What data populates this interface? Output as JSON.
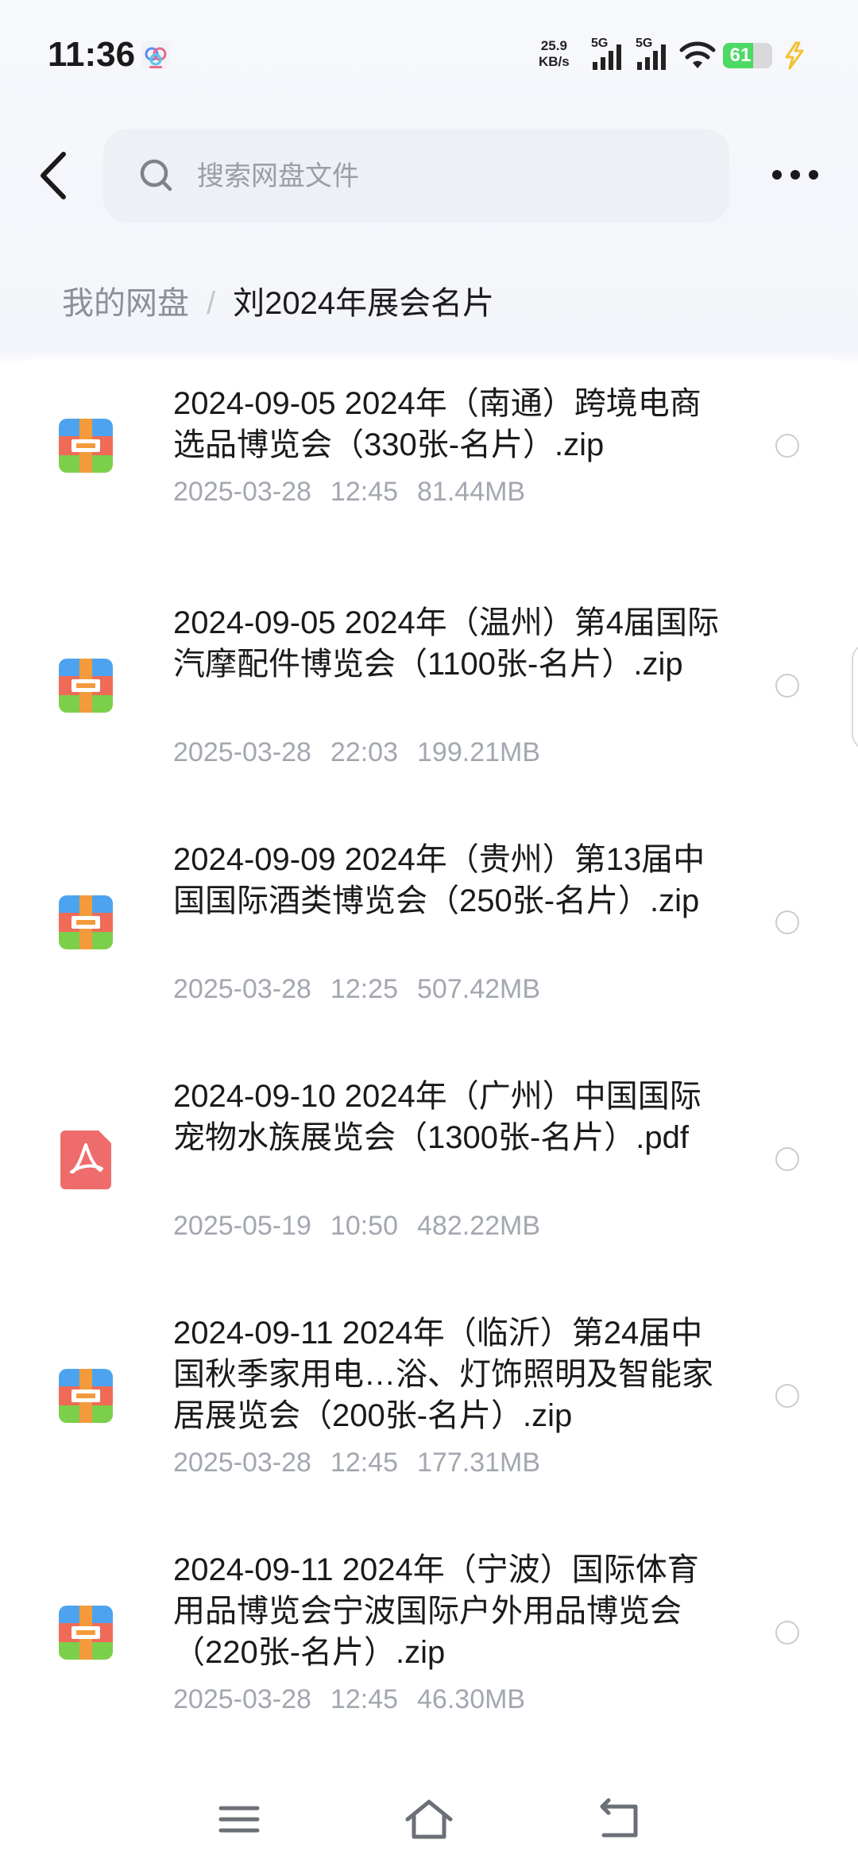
{
  "status_bar": {
    "time": "11:36",
    "net_speed_value": "25.9",
    "net_speed_unit": "KB/s",
    "sim1_label": "5G",
    "sim2_label": "5G",
    "battery_level": "61",
    "battery_fill_percent": 61
  },
  "header": {
    "search_placeholder": "搜索网盘文件"
  },
  "breadcrumb": {
    "root": "我的网盘",
    "separator": "/",
    "current": "刘2024年展会名片"
  },
  "files": [
    {
      "name": "2024-09-05  2024年（南通）跨境电商选品博览会（330张-名片）.zip",
      "date": "2025-03-28",
      "time": "12:45",
      "size": "81.44MB",
      "type": "zip-archive-icon",
      "lines": 2
    },
    {
      "name": "2024-09-05  2024年（温州）第4届国际汽摩配件博览会（1100张-名片）.zip",
      "date": "2025-03-28",
      "time": "22:03",
      "size": "199.21MB",
      "type": "zip-archive-icon",
      "lines": 3
    },
    {
      "name": "2024-09-09  2024年（贵州）第13届中国国际酒类博览会（250张-名片）.zip",
      "date": "2025-03-28",
      "time": "12:25",
      "size": "507.42MB",
      "type": "zip-archive-icon",
      "lines": 3
    },
    {
      "name": "2024-09-10  2024年（广州）中国国际宠物水族展览会（1300张-名片）.pdf",
      "date": "2025-05-19",
      "time": "10:50",
      "size": "482.22MB",
      "type": "pdf-icon",
      "lines": 3
    },
    {
      "name": "2024-09-11  2024年（临沂）第24届中国秋季家用电…浴、灯饰照明及智能家居展览会（200张-名片）.zip",
      "date": "2025-03-28",
      "time": "12:45",
      "size": "177.31MB",
      "type": "zip-archive-icon",
      "lines": 3
    },
    {
      "name": "2024-09-11  2024年（宁波）国际体育用品博览会宁波国际户外用品博览会（220张-名片）.zip",
      "date": "2025-03-28",
      "time": "12:45",
      "size": "46.30MB",
      "type": "zip-archive-icon",
      "lines": 3
    }
  ],
  "colors": {
    "zip_top": "#4da3ef",
    "zip_middle": "#ef6b57",
    "zip_bottom": "#7ccf4a",
    "zip_strap": "#f39b3c",
    "pdf_bg": "#ee6c6c"
  }
}
